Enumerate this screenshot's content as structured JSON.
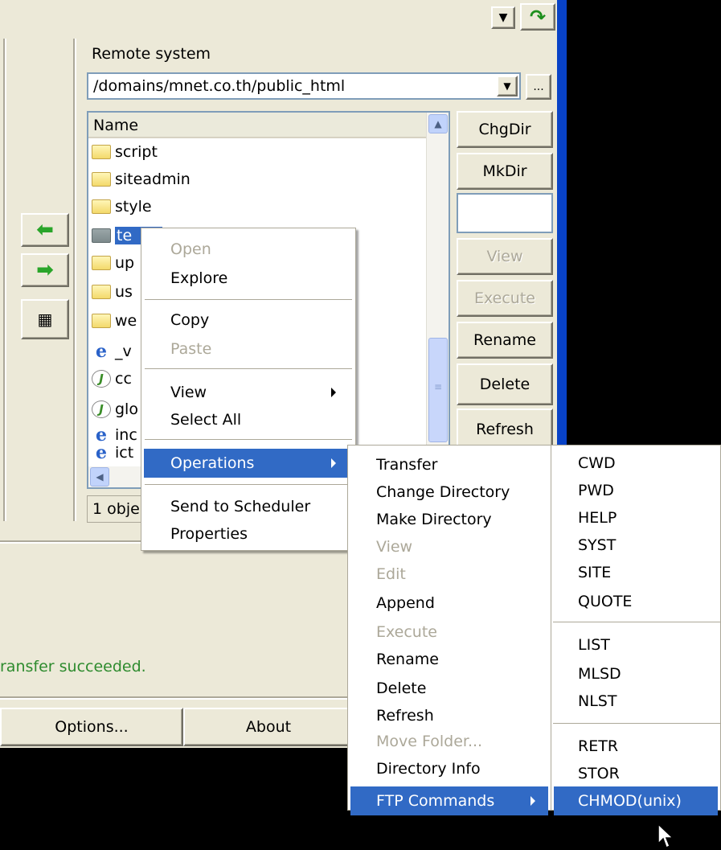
{
  "remote": {
    "title": "Remote system",
    "path": "/domains/mnet.co.th/public_html",
    "browse_label": "...",
    "column_name": "Name",
    "files": [
      {
        "name": "script",
        "icon": "folder-icon"
      },
      {
        "name": "siteadmin",
        "icon": "folder-icon"
      },
      {
        "name": "style",
        "icon": "folder-icon"
      },
      {
        "name": "te",
        "icon": "folder-icon",
        "selected": true
      },
      {
        "name": "up",
        "icon": "folder-icon"
      },
      {
        "name": "us",
        "icon": "folder-icon"
      },
      {
        "name": "we",
        "icon": "folder-icon"
      },
      {
        "name": "_v",
        "icon": "ie-icon"
      },
      {
        "name": "cc",
        "icon": "js-icon"
      },
      {
        "name": "glo",
        "icon": "js-icon"
      },
      {
        "name": "inc",
        "icon": "ie-icon"
      },
      {
        "name": "ict",
        "icon": "ie-icon"
      }
    ],
    "status": "1 obje",
    "buttons": {
      "chgdir": "ChgDir",
      "mkdir": "MkDir",
      "view": "View",
      "execute": "Execute",
      "rename": "Rename",
      "delete": "Delete",
      "refresh": "Refresh"
    }
  },
  "log": {
    "message": "ransfer succeeded.",
    "color": "#2e8b2e"
  },
  "bottom_buttons": {
    "options": "Options...",
    "about": "About"
  },
  "context_menu": {
    "open": "Open",
    "explore": "Explore",
    "copy": "Copy",
    "paste": "Paste",
    "view": "View",
    "select_all": "Select All",
    "operations": "Operations",
    "send_to_scheduler": "Send to Scheduler",
    "properties": "Properties"
  },
  "operations_menu": {
    "transfer": "Transfer",
    "change_directory": "Change Directory",
    "make_directory": "Make Directory",
    "view": "View",
    "edit": "Edit",
    "append": "Append",
    "execute": "Execute",
    "rename": "Rename",
    "delete": "Delete",
    "refresh": "Refresh",
    "move_folder": "Move Folder...",
    "directory_info": "Directory Info",
    "ftp_commands": "FTP Commands"
  },
  "ftp_menu": {
    "cwd": "CWD",
    "pwd": "PWD",
    "help": "HELP",
    "syst": "SYST",
    "site": "SITE",
    "quote": "QUOTE",
    "list": "LIST",
    "mlsd": "MLSD",
    "nlst": "NLST",
    "retr": "RETR",
    "stor": "STOR",
    "chmod": "CHMOD(unix)"
  },
  "colors": {
    "highlight": "#316ac5",
    "window": "#ece9d8",
    "arrow_green": "#2aa52a"
  }
}
